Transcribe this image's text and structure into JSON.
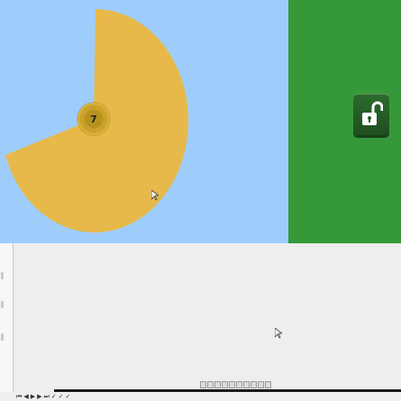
{
  "game": {
    "center_number": "7",
    "colors": {
      "sky": "#9fcdfb",
      "panel": "#35993a",
      "pie": "#e7b94a",
      "badge": "#c8a02c",
      "lock_button": "#245a24"
    },
    "lock": {
      "icon": "unlocked-padlock-icon",
      "state": "unlocked"
    }
  },
  "editor": {
    "playback_icons": [
      "skip-start-icon",
      "step-back-icon",
      "play-icon",
      "step-forward-icon",
      "skip-end-icon"
    ],
    "check_icons": [
      "check-icon",
      "check-icon",
      "check-icon"
    ],
    "toolbar_icons": [
      "tool-1-icon",
      "tool-2-icon",
      "tool-3-icon",
      "tool-4-icon",
      "tool-5-icon",
      "tool-6-icon",
      "tool-7-icon",
      "tool-8-icon",
      "tool-9-icon",
      "tool-10-icon"
    ]
  }
}
